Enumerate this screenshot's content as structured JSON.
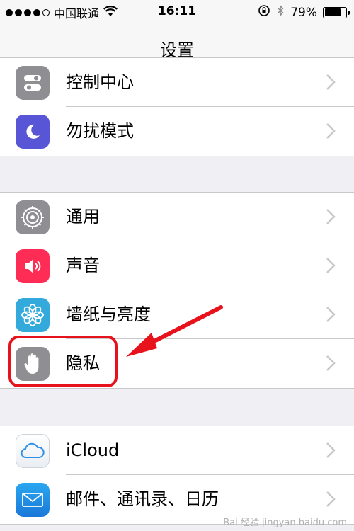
{
  "status_bar": {
    "carrier": "中国联通",
    "time": "16:11",
    "battery_percent": "79%",
    "battery_level": 0.79,
    "signal_dots_filled": 4,
    "signal_dots_total": 5
  },
  "nav": {
    "title": "设置"
  },
  "group1": {
    "items": [
      {
        "label": "控制中心",
        "icon": "control-center-icon",
        "color": "#8e8e93"
      },
      {
        "label": "勿扰模式",
        "icon": "moon-icon",
        "color": "#5856d6"
      }
    ]
  },
  "group2": {
    "items": [
      {
        "label": "通用",
        "icon": "gear-icon",
        "color": "#8e8e93"
      },
      {
        "label": "声音",
        "icon": "speaker-icon",
        "color": "#ff2d55"
      },
      {
        "label": "墙纸与亮度",
        "icon": "flower-icon",
        "color": "#34aadc"
      },
      {
        "label": "隐私",
        "icon": "hand-icon",
        "color": "#8e8e93"
      }
    ]
  },
  "group3": {
    "items": [
      {
        "label": "iCloud",
        "icon": "cloud-icon",
        "color": "#1e88e5"
      },
      {
        "label": "邮件、通讯录、日历",
        "icon": "mail-icon",
        "color": "#1a8fe3"
      }
    ]
  },
  "annotation": {
    "highlight_color": "#e8121c"
  },
  "watermark": "Bai 经验 jingyan.baidu.com"
}
